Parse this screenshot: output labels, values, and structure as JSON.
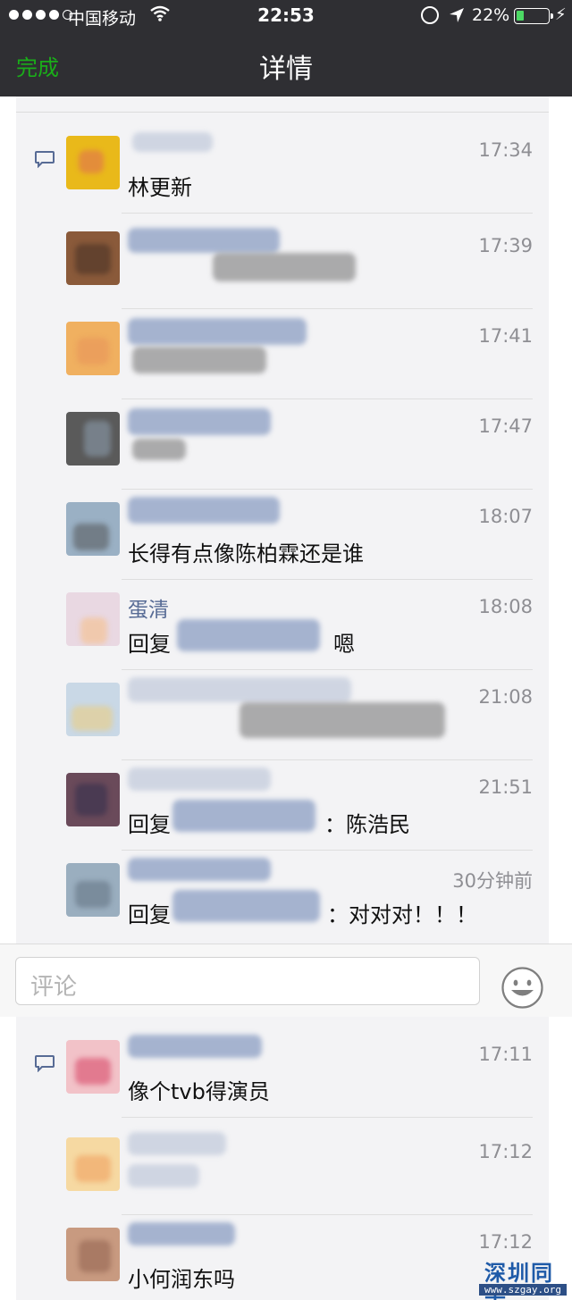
{
  "status_bar": {
    "carrier": "中国移动",
    "time": "22:53",
    "battery_percent": "22%"
  },
  "nav": {
    "done_label": "完成",
    "title": "详情"
  },
  "comments": [
    {
      "name": "",
      "time": "17:34",
      "text": "林更新"
    },
    {
      "name": "",
      "time": "17:39",
      "text": ""
    },
    {
      "name": "",
      "time": "17:41",
      "text": ""
    },
    {
      "name": "",
      "time": "17:47",
      "text": ""
    },
    {
      "name": "",
      "time": "18:07",
      "text": "长得有点像陈柏霖还是谁"
    },
    {
      "name": "蛋清",
      "time": "18:08",
      "text": "回复",
      "text_tail": "嗯"
    },
    {
      "name": "",
      "time": "21:08",
      "text": ""
    },
    {
      "name": "",
      "time": "21:51",
      "text": "回复",
      "text_tail": "：陈浩民"
    },
    {
      "name": "",
      "time": "30分钟前",
      "text": "回复",
      "text_tail": "：对对对！！！"
    }
  ],
  "comment_input": {
    "placeholder": "评论"
  },
  "comments2": [
    {
      "name": "",
      "time": "17:11",
      "text": "像个tvb得演员"
    },
    {
      "name": "",
      "time": "17:12",
      "text": ""
    },
    {
      "name": "",
      "time": "17:12",
      "text": "小何润东吗"
    }
  ],
  "watermark": {
    "title": "深圳同志",
    "url": "www.szgay.org"
  },
  "colors": {
    "accent_green": "#1aad19",
    "name_blue": "#576b95",
    "nav_bg": "#2f2f33"
  }
}
